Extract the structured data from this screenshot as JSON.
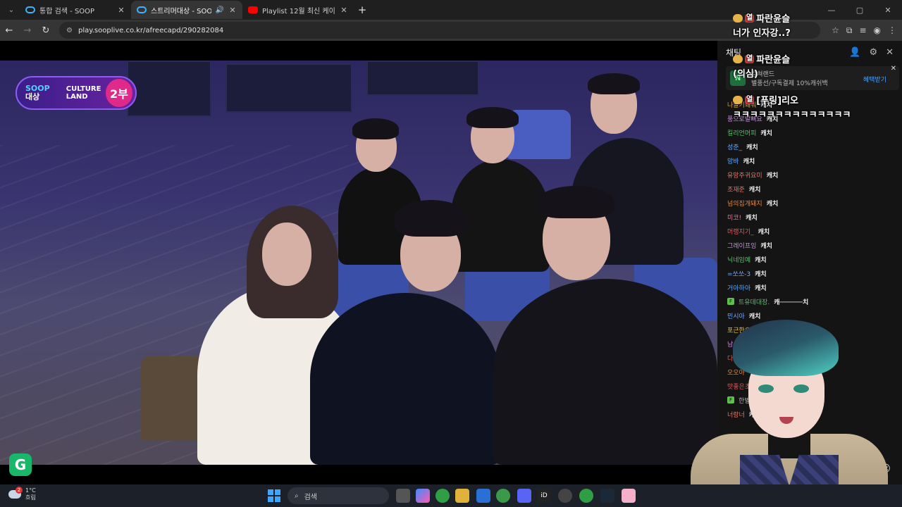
{
  "browser": {
    "tabs": [
      {
        "title": "통합 검색 - SOOP",
        "icon": "soop-icon",
        "active": false
      },
      {
        "title": "스트리머대상 - SOOP",
        "icon": "soop-icon",
        "active": true
      },
      {
        "title": "Playlist 12월 최신 케이팝 신곡",
        "icon": "youtube-icon",
        "active": false
      }
    ],
    "url": "play.sooplive.co.kr/afreecapd/290282084"
  },
  "video": {
    "logo": {
      "line1": "SOOP",
      "line2": "대상",
      "line3": "CULTURE LAND",
      "part": "2부"
    },
    "corner_badge": "G"
  },
  "overlay_messages": [
    {
      "user": "파란윤슬",
      "text": "너가 인자강..?"
    },
    {
      "user": "파란윤슬",
      "text": "(의심)"
    },
    {
      "user": "[푸링]리오",
      "text": "ㅋㅋㅋㅋㅋㅋㅋㅋㅋㅋㅋㅋㅋㅋ"
    }
  ],
  "chat": {
    "title": "채팅",
    "promo": {
      "badge": "N",
      "line1": "컬쳐랜드",
      "line2": "별풍선/구독결제 10%캐쉬백",
      "cta": "혜택받기"
    },
    "messages": [
      {
        "nick": "나끌기쇄워",
        "color": "#d6a34c",
        "text": "캐치"
      },
      {
        "nick": "풍으로발뻐요",
        "color": "#c98ee0",
        "text": "캐치"
      },
      {
        "nick": "킬리언머피",
        "color": "#56c26a",
        "text": "캐치"
      },
      {
        "nick": "성준_",
        "color": "#79a8ff",
        "text": "캐치"
      },
      {
        "nick": "망바",
        "color": "#5fa9ff",
        "text": "캐치"
      },
      {
        "nick": "유망주귀요미",
        "color": "#e07a6a",
        "text": "캐치"
      },
      {
        "nick": "조재준",
        "color": "#e07a6a",
        "text": "캐치"
      },
      {
        "nick": "넘의집개돼지",
        "color": "#e0884a",
        "text": "캐치"
      },
      {
        "nick": "미코!",
        "color": "#e07a9a",
        "text": "캐치"
      },
      {
        "nick": "머랭지기_",
        "color": "#e05a5a",
        "text": "캐치"
      },
      {
        "nick": "그레이프잉",
        "color": "#c98ee0",
        "text": "캐치"
      },
      {
        "nick": "닉네임예",
        "color": "#56c26a",
        "text": "캐치"
      },
      {
        "nick": "=쏘쏘-3",
        "color": "#79a8ff",
        "text": "캐치"
      },
      {
        "nick": "거아하아",
        "color": "#5fa9ff",
        "text": "캐치"
      },
      {
        "nick": "트유데대장.",
        "color": "#56c26a",
        "text": "캐──────치",
        "badge": "F"
      },
      {
        "nick": "민시아",
        "color": "#79a8ff",
        "text": "캐치"
      },
      {
        "nick": "포근한오후",
        "color": "#e0c04a",
        "text": ""
      },
      {
        "nick": "남순맘",
        "color": "#c98ee0",
        "text": ""
      },
      {
        "nick": "다찌",
        "color": "#e05a5a",
        "text": ""
      },
      {
        "nick": "오오아",
        "color": "#e0884a",
        "text": ""
      },
      {
        "nick": "맛좋은초",
        "color": "#e05a5a",
        "text": ""
      },
      {
        "nick": "한별*",
        "color": "#aaaaaa",
        "text": "",
        "badge": "F"
      },
      {
        "nick": "너랑너",
        "color": "#e07a6a",
        "text": "캐치"
      }
    ]
  },
  "taskbar": {
    "weather_temp": "1°C",
    "weather_desc": "흐림",
    "weather_count": "2",
    "search_placeholder": "검색"
  }
}
